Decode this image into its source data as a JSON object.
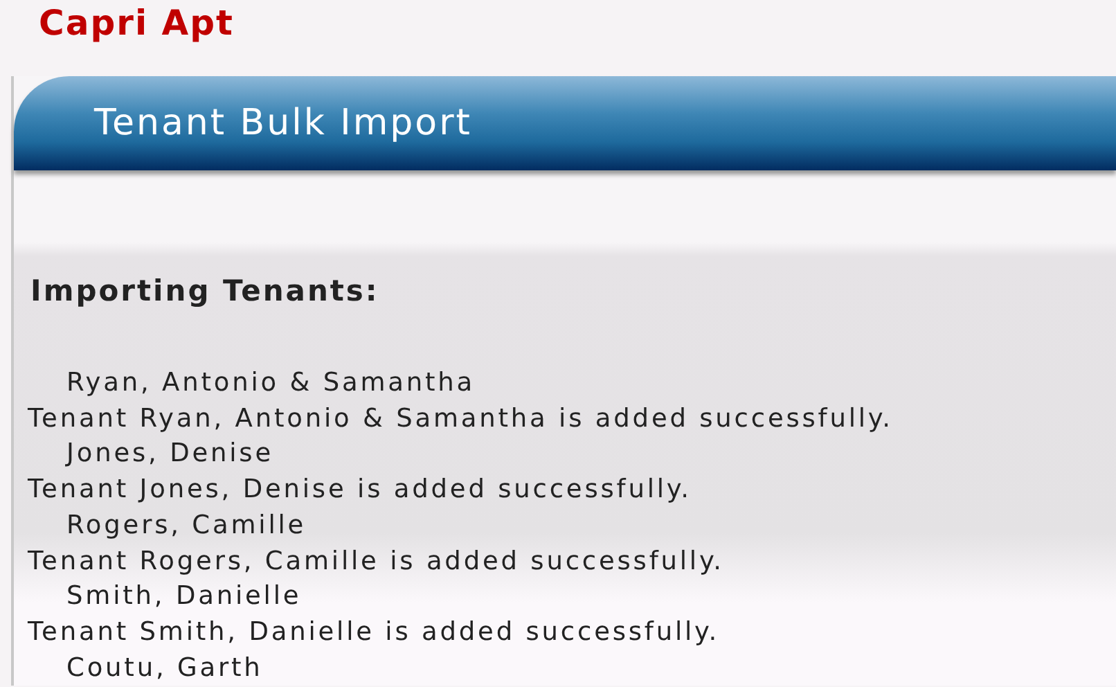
{
  "app_name": "Capri Apt",
  "panel": {
    "title": "Tenant Bulk Import",
    "heading": "Importing Tenants:",
    "log": [
      {
        "kind": "name",
        "text": "Ryan, Antonio & Samantha"
      },
      {
        "kind": "result",
        "text": "Tenant Ryan, Antonio & Samantha is added successfully."
      },
      {
        "kind": "name",
        "text": "Jones, Denise"
      },
      {
        "kind": "result",
        "text": "Tenant Jones, Denise is added successfully."
      },
      {
        "kind": "name",
        "text": "Rogers, Camille"
      },
      {
        "kind": "result",
        "text": "Tenant Rogers, Camille is added successfully."
      },
      {
        "kind": "name",
        "text": "Smith, Danielle"
      },
      {
        "kind": "result",
        "text": "Tenant Smith, Danielle is added successfully."
      },
      {
        "kind": "name",
        "text": "Coutu, Garth"
      }
    ]
  }
}
